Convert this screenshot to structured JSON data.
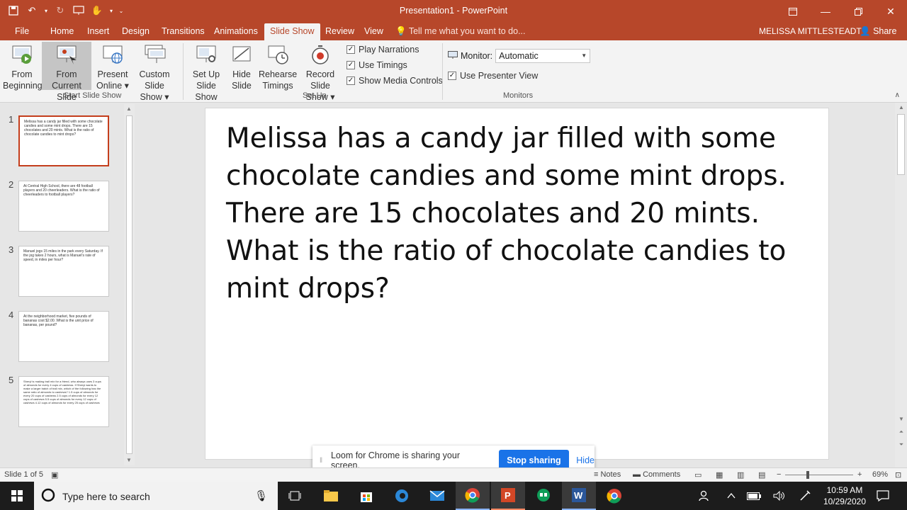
{
  "window": {
    "title": "Presentation1 - PowerPoint"
  },
  "tabs": [
    {
      "label": "File"
    },
    {
      "label": "Home"
    },
    {
      "label": "Insert"
    },
    {
      "label": "Design"
    },
    {
      "label": "Transitions"
    },
    {
      "label": "Animations"
    },
    {
      "label": "Slide Show"
    },
    {
      "label": "Review"
    },
    {
      "label": "View"
    }
  ],
  "tell_me": "Tell me what you want to do...",
  "user_name": "MELISSA MITTLESTEADT",
  "share_label": "Share",
  "ribbon": {
    "start_group": {
      "label": "Start Slide Show",
      "from_beginning": [
        "From",
        "Beginning"
      ],
      "from_current": [
        "From",
        "Current Slide"
      ],
      "present_online": [
        "Present",
        "Online ▾"
      ],
      "custom_show": [
        "Custom Slide",
        "Show ▾"
      ]
    },
    "setup_group": {
      "label": "Set Up",
      "setup_show": [
        "Set Up",
        "Slide Show"
      ],
      "hide_slide": [
        "Hide",
        "Slide"
      ],
      "rehearse": [
        "Rehearse",
        "Timings"
      ],
      "record": [
        "Record Slide",
        "Show ▾"
      ],
      "play_narrations": "Play Narrations",
      "use_timings": "Use Timings",
      "show_media": "Show Media Controls"
    },
    "monitors_group": {
      "label": "Monitors",
      "monitor_label": "Monitor:",
      "monitor_value": "Automatic",
      "presenter_view": "Use Presenter View"
    }
  },
  "slides": [
    {
      "num": "1",
      "text": "Melissa has a candy jar filled with some chocolate candies and some mint drops. There are 15 chocolates and 20 mints. What is the ratio of chocolate candies to mint drops?"
    },
    {
      "num": "2",
      "text": "At Central High School, there are 48 football players and 20 cheerleaders. What is the ratio of cheerleaders to football players?"
    },
    {
      "num": "3",
      "text": "Manuel jogs 15 miles in the park every Saturday. If the jog takes 2 hours, what is Manuel's rate of speed, in miles per hour?"
    },
    {
      "num": "4",
      "text": "At the neighborhood market, five pounds of bananas cost $2.00. What is the unit price of bananas, per pound?"
    },
    {
      "num": "5",
      "text": "Sheryl is making trail mix for a friend, who always uses 3 cups of almonds for every 4 cups of cashews. If Sheryl wants to make a larger batch of trail mix, which of the following has the same ratio of almonds to cashews? 1.5 cups of almonds for every 20 cups of cashews 2.5 cups of almonds for every 12 cups of cashews 5.5 cups of almonds for every 12 cups of cashews 4.12 cups of almonds for every 25 cups of cashews"
    }
  ],
  "main_slide_text": "Melissa has a candy jar filled with some chocolate candies and some mint drops. There are 15 chocolates and 20 mints. What is the ratio of chocolate candies to mint drops?",
  "loom": {
    "message": "Loom for Chrome is sharing your screen.",
    "stop": "Stop sharing",
    "hide": "Hide"
  },
  "status": {
    "slide_info": "Slide 1 of 5",
    "notes": "Notes",
    "comments": "Comments",
    "zoom": "69%"
  },
  "taskbar": {
    "search_placeholder": "Type here to search",
    "time": "10:59 AM",
    "date": "10/29/2020"
  },
  "colors": {
    "accent": "#b7472a",
    "selected_border": "#c43e1c",
    "loom_blue": "#1a73e8"
  }
}
